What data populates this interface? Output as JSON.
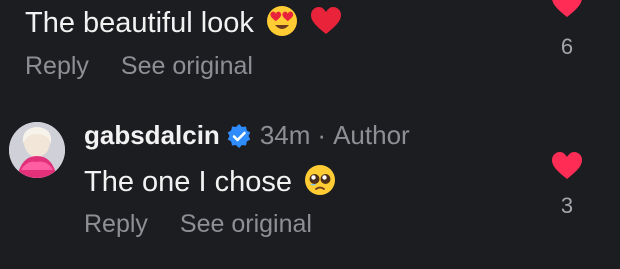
{
  "comments": [
    {
      "text": "The beautiful look",
      "emojis": [
        "heart-eyes-emoji",
        "red-heart-emoji"
      ],
      "reply_label": "Reply",
      "see_original_label": "See original",
      "like_count": "6"
    },
    {
      "username": "gabsdalcin",
      "verified": true,
      "time": "34m",
      "separator": "·",
      "author_label": "Author",
      "text": "The one I chose",
      "emojis": [
        "pleading-face-emoji"
      ],
      "reply_label": "Reply",
      "see_original_label": "See original",
      "like_count": "3"
    }
  ],
  "colors": {
    "background": "#1c1d21",
    "text": "#f2f2f2",
    "muted": "#8e8f94",
    "like_red": "#ff2c55",
    "verified_blue": "#2f8cff"
  }
}
